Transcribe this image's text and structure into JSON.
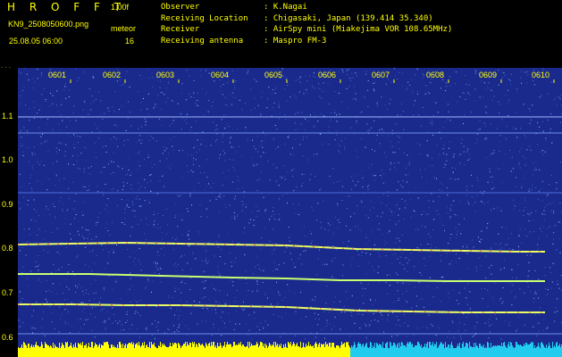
{
  "app": {
    "logo": "H R O F F T",
    "version": "1.00f"
  },
  "info": {
    "filename": "KN9_2508050600.png",
    "plot_type": "meteor",
    "datetime": "25.08.05 06:00",
    "count": "16"
  },
  "metadata": [
    {
      "key": "Observer",
      "sep": ":",
      "value": "K.Nagai"
    },
    {
      "key": "Receiving Location",
      "sep": ":",
      "value": "Chigasaki, Japan (139.414 35.340)"
    },
    {
      "key": "Receiver",
      "sep": ":",
      "value": "AirSpy mini (Miakejima VOR 108.65MHz)"
    },
    {
      "key": "Receiving antenna",
      "sep": ":",
      "value": "Maspro FM-3"
    }
  ],
  "spectrogram": {
    "y_unit": "kHz",
    "y_ticks": [
      "1.1",
      "1.0",
      "0.9",
      "0.8",
      "0.7",
      "0.6"
    ],
    "time_ticks": [
      "0601",
      "0602",
      "0603",
      "0604",
      "0605",
      "0606",
      "0607",
      "0608",
      "0609",
      "0610"
    ],
    "background_color": "#1a2a8c",
    "trace_color": "#ffff40",
    "baseline_color": "#ffff00",
    "baseline_alt_color": "#22ccee"
  }
}
